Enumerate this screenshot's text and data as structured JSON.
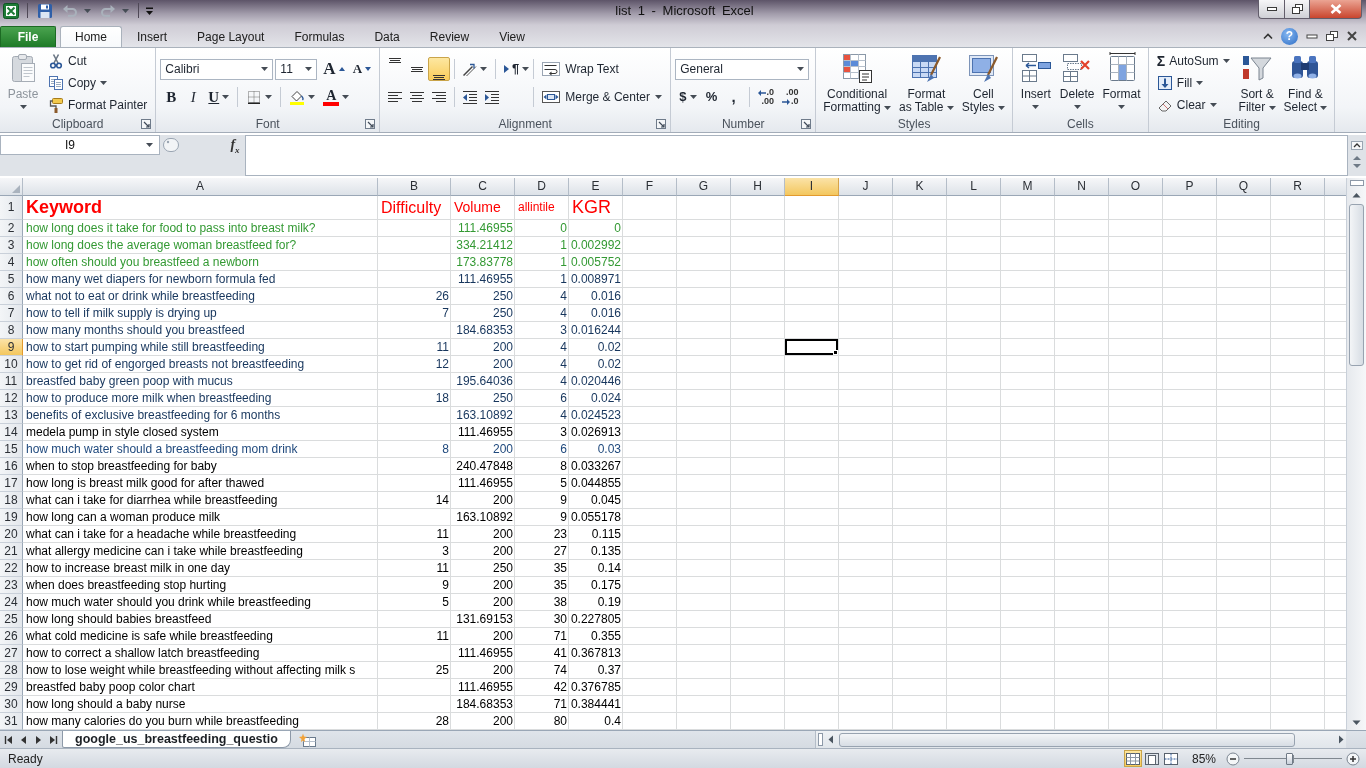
{
  "window": {
    "title": "list 1 - Microsoft Excel"
  },
  "quick_access": [
    {
      "kind": "save",
      "disabled": false
    },
    {
      "kind": "undo",
      "disabled": true
    },
    {
      "kind": "redo",
      "disabled": true
    }
  ],
  "tabs": [
    {
      "label": "File",
      "kind": "backstage",
      "selected": false
    },
    {
      "label": "Home",
      "kind": "ribbon",
      "selected": true
    },
    {
      "label": "Insert",
      "kind": "ribbon",
      "selected": false
    },
    {
      "label": "Page Layout",
      "kind": "ribbon",
      "selected": false
    },
    {
      "label": "Formulas",
      "kind": "ribbon",
      "selected": false
    },
    {
      "label": "Data",
      "kind": "ribbon",
      "selected": false
    },
    {
      "label": "Review",
      "kind": "ribbon",
      "selected": false
    },
    {
      "label": "View",
      "kind": "ribbon",
      "selected": false
    }
  ],
  "help": "?",
  "ribbon": {
    "groups": [
      {
        "label": "Clipboard",
        "launcher": true,
        "stacks": [
          {
            "controls": [
              {
                "kind": "paste",
                "label": [
                  "Paste"
                ],
                "menu": true,
                "disabled": true
              }
            ]
          },
          {
            "controls": [
              {
                "kind": "cut",
                "label": [
                  "Cut"
                ]
              },
              {
                "kind": "copy",
                "label": [
                  "Copy"
                ],
                "menu": true
              },
              {
                "kind": "format-painter",
                "label": [
                  "Format Painter"
                ]
              }
            ]
          }
        ]
      },
      {
        "label": "Font",
        "launcher": true,
        "lines": [
          {
            "controls": [
              {
                "kind": "font-name",
                "value": "Calibri"
              },
              {
                "kind": "font-size",
                "value": "11"
              },
              {
                "kind": "grow-font",
                "glyph": "A"
              },
              {
                "kind": "shrink-font",
                "glyph": "A"
              }
            ]
          },
          {
            "controls": [
              {
                "kind": "bold",
                "glyph": "B",
                "selected": false
              },
              {
                "kind": "italic",
                "glyph": "I",
                "selected": false
              },
              {
                "kind": "underline",
                "glyph": "U",
                "selected": false,
                "menu": true
              },
              {
                "kind": "separator"
              },
              {
                "kind": "borders",
                "menu": true
              },
              {
                "kind": "separator"
              },
              {
                "kind": "fill-color",
                "menu": true
              },
              {
                "kind": "font-color",
                "glyph": "A",
                "menu": true
              }
            ]
          }
        ]
      },
      {
        "label": "Alignment",
        "launcher": true,
        "lines": [
          {
            "controls": [
              {
                "kind": "align-top",
                "selected": false
              },
              {
                "kind": "align-middle",
                "selected": false
              },
              {
                "kind": "align-bottom",
                "selected": true
              },
              {
                "kind": "separator"
              },
              {
                "kind": "orientation",
                "menu": true
              },
              {
                "kind": "separator"
              },
              {
                "kind": "text-direction",
                "glyph": "¶",
                "menu": true
              },
              {
                "kind": "separator"
              },
              {
                "kind": "wrap-text",
                "label": [
                  "Wrap Text"
                ]
              }
            ]
          },
          {
            "controls": [
              {
                "kind": "align-left",
                "selected": false
              },
              {
                "kind": "align-center",
                "selected": false
              },
              {
                "kind": "align-right",
                "selected": false
              },
              {
                "kind": "separator"
              },
              {
                "kind": "decrease-indent"
              },
              {
                "kind": "increase-indent"
              },
              {
                "kind": "separator"
              },
              {
                "kind": "merge-center",
                "label": [
                  "Merge & Center"
                ],
                "menu": true
              }
            ]
          }
        ]
      },
      {
        "label": "Number",
        "launcher": true,
        "lines": [
          {
            "controls": [
              {
                "kind": "number-format",
                "value": "General"
              }
            ]
          },
          {
            "controls": [
              {
                "kind": "currency",
                "glyph": "$",
                "menu": true
              },
              {
                "kind": "percent",
                "glyph": "%"
              },
              {
                "kind": "comma",
                "glyph": ","
              },
              {
                "kind": "separator"
              },
              {
                "kind": "increase-decimal",
                "glyph": [
                  ".0",
                  ".00"
                ]
              },
              {
                "kind": "decrease-decimal",
                "glyph": [
                  ".00",
                  ".0"
                ]
              }
            ]
          }
        ]
      },
      {
        "label": "Styles",
        "launcher": false,
        "stacks": [
          {
            "controls": [
              {
                "kind": "conditional-formatting",
                "label": [
                  "Conditional",
                  "Formatting"
                ],
                "menu": true
              }
            ]
          },
          {
            "controls": [
              {
                "kind": "format-as-table",
                "label": [
                  "Format",
                  "as Table"
                ],
                "menu": true
              }
            ]
          },
          {
            "controls": [
              {
                "kind": "cell-styles",
                "label": [
                  "Cell",
                  "Styles"
                ],
                "menu": true
              }
            ]
          }
        ]
      },
      {
        "label": "Cells",
        "launcher": false,
        "stacks": [
          {
            "controls": [
              {
                "kind": "insert-cells",
                "label": [
                  "Insert"
                ],
                "menu": true
              }
            ]
          },
          {
            "controls": [
              {
                "kind": "delete-cells",
                "label": [
                  "Delete"
                ],
                "menu": true
              }
            ]
          },
          {
            "controls": [
              {
                "kind": "format-cells",
                "label": [
                  "Format"
                ],
                "menu": true
              }
            ]
          }
        ]
      },
      {
        "label": "Editing",
        "launcher": false,
        "stacks": [
          {
            "controls": [
              {
                "kind": "autosum",
                "glyph": "Σ",
                "label": [
                  "AutoSum"
                ],
                "menu": true
              },
              {
                "kind": "fill",
                "label": [
                  "Fill"
                ],
                "menu": true
              },
              {
                "kind": "clear",
                "label": [
                  "Clear"
                ],
                "menu": true
              }
            ]
          },
          {
            "controls": [
              {
                "kind": "sort-filter",
                "label": [
                  "Sort &",
                  "Filter"
                ],
                "menu": true
              }
            ]
          },
          {
            "controls": [
              {
                "kind": "find-select",
                "label": [
                  "Find &",
                  "Select"
                ],
                "menu": true
              }
            ]
          }
        ]
      }
    ]
  },
  "formula_bar": {
    "name_box": "I9",
    "function_glyph": "f$_{x}$"
  },
  "sheet": {
    "columns": [
      {
        "label": "A",
        "selected": false
      },
      {
        "label": "B",
        "selected": false
      },
      {
        "label": "C",
        "selected": false
      },
      {
        "label": "D",
        "selected": false
      },
      {
        "label": "E",
        "selected": false
      },
      {
        "label": "F",
        "selected": false
      },
      {
        "label": "G",
        "selected": false
      },
      {
        "label": "H",
        "selected": false
      },
      {
        "label": "I",
        "selected": true
      },
      {
        "label": "J",
        "selected": false
      },
      {
        "label": "K",
        "selected": false
      },
      {
        "label": "L",
        "selected": false
      },
      {
        "label": "M",
        "selected": false
      },
      {
        "label": "N",
        "selected": false
      },
      {
        "label": "O",
        "selected": false
      },
      {
        "label": "P",
        "selected": false
      },
      {
        "label": "Q",
        "selected": false
      },
      {
        "label": "R",
        "selected": false
      }
    ],
    "header_row": {
      "number": "1",
      "selected": false,
      "color": "#ff0000",
      "cells": {
        "keyword": "Keyword",
        "difficulty": "Difficulty",
        "volume": "Volume",
        "allintitle": "allintile",
        "kgr": "KGR"
      }
    },
    "rows": [
      {
        "number": "2",
        "selected": false,
        "color": "#339933",
        "cells": {
          "keyword": "how long does it take for food to pass into breast milk?",
          "volume": "111.46955",
          "allintitle": "0",
          "kgr": "0"
        }
      },
      {
        "number": "3",
        "selected": false,
        "color": "#339933",
        "cells": {
          "keyword": "how long does the average woman breastfeed for?",
          "volume": "334.21412",
          "allintitle": "1",
          "kgr": "0.002992"
        }
      },
      {
        "number": "4",
        "selected": false,
        "color": "#339933",
        "cells": {
          "keyword": "how often should you breastfeed a newborn",
          "volume": "173.83778",
          "allintitle": "1",
          "kgr": "0.005752"
        }
      },
      {
        "number": "5",
        "selected": false,
        "color": "#17365d",
        "cells": {
          "keyword": "how many wet diapers for newborn formula fed",
          "volume": "111.46955",
          "allintitle": "1",
          "kgr": "0.008971"
        }
      },
      {
        "number": "6",
        "selected": false,
        "color": "#17365d",
        "cells": {
          "keyword": "what not to eat or drink while breastfeeding",
          "difficulty": "26",
          "volume": "250",
          "allintitle": "4",
          "kgr": "0.016"
        }
      },
      {
        "number": "7",
        "selected": false,
        "color": "#17365d",
        "cells": {
          "keyword": "how to tell if milk supply is drying up",
          "difficulty": "7",
          "volume": "250",
          "allintitle": "4",
          "kgr": "0.016"
        }
      },
      {
        "number": "8",
        "selected": false,
        "color": "#17365d",
        "cells": {
          "keyword": "how many months should you breastfeed",
          "volume": "184.68353",
          "allintitle": "3",
          "kgr": "0.016244"
        }
      },
      {
        "number": "9",
        "selected": true,
        "color": "#17365d",
        "cells": {
          "keyword": "how to start pumping while still breastfeeding",
          "difficulty": "11",
          "volume": "200",
          "allintitle": "4",
          "kgr": "0.02"
        }
      },
      {
        "number": "10",
        "selected": false,
        "color": "#17365d",
        "cells": {
          "keyword": "how to get rid of engorged breasts not breastfeeding",
          "difficulty": "12",
          "volume": "200",
          "allintitle": "4",
          "kgr": "0.02"
        }
      },
      {
        "number": "11",
        "selected": false,
        "color": "#17365d",
        "cells": {
          "keyword": "breastfed baby green poop with mucus",
          "volume": "195.64036",
          "allintitle": "4",
          "kgr": "0.020446"
        }
      },
      {
        "number": "12",
        "selected": false,
        "color": "#17365d",
        "cells": {
          "keyword": "how to produce more milk when breastfeeding",
          "difficulty": "18",
          "volume": "250",
          "allintitle": "6",
          "kgr": "0.024"
        }
      },
      {
        "number": "13",
        "selected": false,
        "color": "#17365d",
        "cells": {
          "keyword": "benefits of exclusive breastfeeding for 6 months",
          "volume": "163.10892",
          "allintitle": "4",
          "kgr": "0.024523"
        }
      },
      {
        "number": "14",
        "selected": false,
        "color": "#000000",
        "cells": {
          "keyword": "medela pump in style closed system",
          "volume": "111.46955",
          "allintitle": "3",
          "kgr": "0.026913"
        }
      },
      {
        "number": "15",
        "selected": false,
        "color": "#1f497d",
        "cells": {
          "keyword": "how much water should a breastfeeding mom drink",
          "difficulty": "8",
          "volume": "200",
          "allintitle": "6",
          "kgr": "0.03"
        }
      },
      {
        "number": "16",
        "selected": false,
        "color": "#000000",
        "cells": {
          "keyword": "when to stop breastfeeding for baby",
          "volume": "240.47848",
          "allintitle": "8",
          "kgr": "0.033267"
        }
      },
      {
        "number": "17",
        "selected": false,
        "color": "#000000",
        "cells": {
          "keyword": "how long is breast milk good for after thawed",
          "volume": "111.46955",
          "allintitle": "5",
          "kgr": "0.044855"
        }
      },
      {
        "number": "18",
        "selected": false,
        "color": "#000000",
        "cells": {
          "keyword": "what can i take for diarrhea while breastfeeding",
          "difficulty": "14",
          "volume": "200",
          "allintitle": "9",
          "kgr": "0.045"
        }
      },
      {
        "number": "19",
        "selected": false,
        "color": "#000000",
        "cells": {
          "keyword": "how long can a woman produce milk",
          "volume": "163.10892",
          "allintitle": "9",
          "kgr": "0.055178"
        }
      },
      {
        "number": "20",
        "selected": false,
        "color": "#000000",
        "cells": {
          "keyword": "what can i take for a headache while breastfeeding",
          "difficulty": "11",
          "volume": "200",
          "allintitle": "23",
          "kgr": "0.115"
        }
      },
      {
        "number": "21",
        "selected": false,
        "color": "#000000",
        "cells": {
          "keyword": "what allergy medicine can i take while breastfeeding",
          "difficulty": "3",
          "volume": "200",
          "allintitle": "27",
          "kgr": "0.135"
        }
      },
      {
        "number": "22",
        "selected": false,
        "color": "#000000",
        "cells": {
          "keyword": "how to increase breast milk in one day",
          "difficulty": "11",
          "volume": "250",
          "allintitle": "35",
          "kgr": "0.14"
        }
      },
      {
        "number": "23",
        "selected": false,
        "color": "#000000",
        "cells": {
          "keyword": "when does breastfeeding stop hurting",
          "difficulty": "9",
          "volume": "200",
          "allintitle": "35",
          "kgr": "0.175"
        }
      },
      {
        "number": "24",
        "selected": false,
        "color": "#000000",
        "cells": {
          "keyword": "how much water should you drink while breastfeeding",
          "difficulty": "5",
          "volume": "200",
          "allintitle": "38",
          "kgr": "0.19"
        }
      },
      {
        "number": "25",
        "selected": false,
        "color": "#000000",
        "cells": {
          "keyword": "how long should babies breastfeed",
          "volume": "131.69153",
          "allintitle": "30",
          "kgr": "0.227805"
        }
      },
      {
        "number": "26",
        "selected": false,
        "color": "#000000",
        "cells": {
          "keyword": "what cold medicine is safe while breastfeeding",
          "difficulty": "11",
          "volume": "200",
          "allintitle": "71",
          "kgr": "0.355"
        }
      },
      {
        "number": "27",
        "selected": false,
        "color": "#000000",
        "cells": {
          "keyword": "how to correct a shallow latch breastfeeding",
          "volume": "111.46955",
          "allintitle": "41",
          "kgr": "0.367813"
        }
      },
      {
        "number": "28",
        "selected": false,
        "color": "#000000",
        "cells": {
          "keyword": "how to lose weight while breastfeeding without affecting milk s",
          "difficulty": "25",
          "volume": "200",
          "allintitle": "74",
          "kgr": "0.37"
        }
      },
      {
        "number": "29",
        "selected": false,
        "color": "#000000",
        "cells": {
          "keyword": "breastfed baby poop color chart",
          "volume": "111.46955",
          "allintitle": "42",
          "kgr": "0.376785"
        }
      },
      {
        "number": "30",
        "selected": false,
        "color": "#000000",
        "cells": {
          "keyword": "how long should a baby nurse",
          "volume": "184.68353",
          "allintitle": "71",
          "kgr": "0.384441"
        }
      },
      {
        "number": "31",
        "selected": false,
        "color": "#000000",
        "cells": {
          "keyword": "how many calories do you burn while breastfeeding",
          "difficulty": "28",
          "volume": "200",
          "allintitle": "80",
          "kgr": "0.4"
        }
      }
    ]
  },
  "sheet_tabs": [
    {
      "label": "google_us_breastfeeding_questio",
      "selected": true
    }
  ],
  "status_bar": {
    "text": "Ready",
    "views": [
      {
        "kind": "normal",
        "selected": true
      },
      {
        "kind": "page-layout",
        "selected": false
      },
      {
        "kind": "page-break-preview",
        "selected": false
      }
    ],
    "zoom": {
      "reading": "85%",
      "level": 0.46
    }
  }
}
